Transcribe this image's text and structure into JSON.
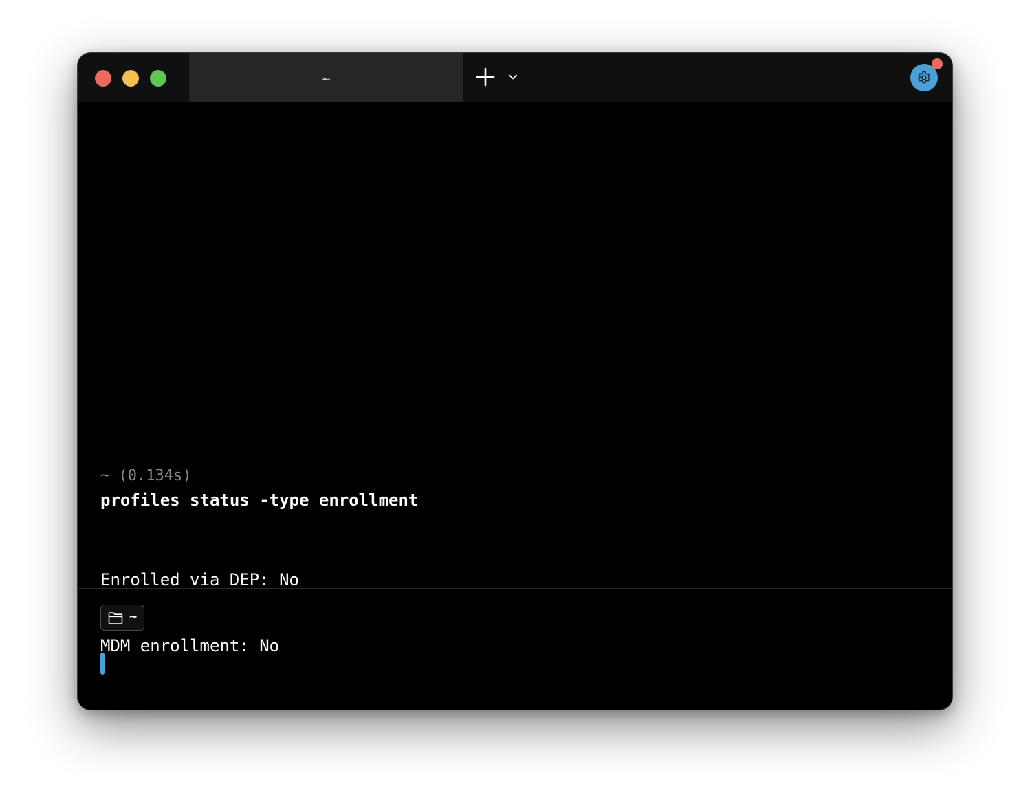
{
  "window": {
    "tabs": [
      {
        "title": "~",
        "active": true
      }
    ],
    "icons": {
      "new_tab": "plus-icon",
      "tab_menu": "chevron-down-icon",
      "settings": "gear-icon",
      "directory": "folder-icon"
    },
    "colors": {
      "accent": "#4aa1d8",
      "notification": "#ed6a5e",
      "close": "#ed6a5e",
      "minimize": "#f4bf4f",
      "maximize": "#61c554"
    }
  },
  "block": {
    "meta": "~ (0.134s)",
    "command": "profiles status -type enrollment",
    "output": [
      "Enrolled via DEP: No",
      "MDM enrollment: No"
    ]
  },
  "prompt": {
    "directory": "~",
    "input_value": ""
  }
}
